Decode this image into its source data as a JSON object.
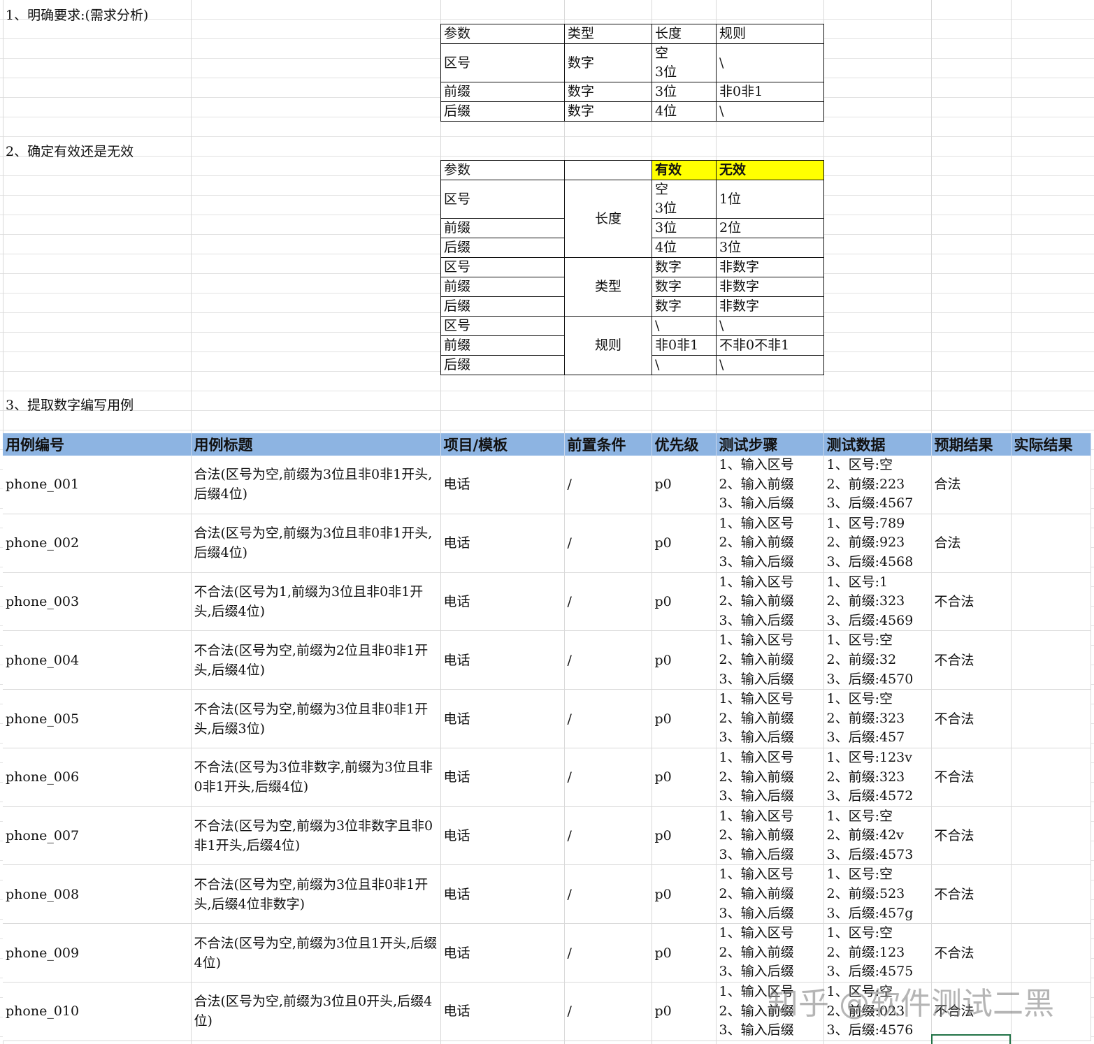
{
  "section1": "1、明确要求:(需求分析)",
  "section2": "2、确定有效还是无效",
  "section3": "3、提取数字编写用例",
  "table1": {
    "headers": [
      "参数",
      "类型",
      "长度",
      "规则"
    ],
    "rows": [
      [
        "区号",
        "数字",
        "空\n3位",
        "\\"
      ],
      [
        "前缀",
        "数字",
        "3位",
        "非0非1"
      ],
      [
        "后缀",
        "数字",
        "4位",
        "\\"
      ]
    ]
  },
  "table2": {
    "header_param": "参数",
    "header_valid": "有效",
    "header_invalid": "无效",
    "groups": [
      {
        "name": "长度",
        "rows": [
          [
            "区号",
            "空\n3位",
            "1位"
          ],
          [
            "前缀",
            "3位",
            "2位"
          ],
          [
            "后缀",
            "4位",
            "3位"
          ]
        ]
      },
      {
        "name": "类型",
        "rows": [
          [
            "区号",
            "数字",
            "非数字"
          ],
          [
            "前缀",
            "数字",
            "非数字"
          ],
          [
            "后缀",
            "数字",
            "非数字"
          ]
        ]
      },
      {
        "name": "规则",
        "rows": [
          [
            "区号",
            "\\",
            "\\"
          ],
          [
            "前缀",
            "非0非1",
            "不非0不非1"
          ],
          [
            "后缀",
            "\\",
            "\\"
          ]
        ]
      }
    ]
  },
  "cases": {
    "headers": [
      "用例编号",
      "用例标题",
      "项目/模板",
      "前置条件",
      "优先级",
      "测试步骤",
      "测试数据",
      "预期结果",
      "实际结果"
    ],
    "rows": [
      {
        "id": "phone_001",
        "title": "合法(区号为空,前缀为3位且非0非1开头,后缀4位)",
        "module": "电话",
        "pre": "/",
        "priority": "p0",
        "steps": [
          "1、输入区号",
          "2、输入前缀",
          "3、输入后缀"
        ],
        "data": [
          "1、区号:空",
          "2、前缀:223",
          "3、后缀:4567"
        ],
        "expected": "合法",
        "actual": ""
      },
      {
        "id": "phone_002",
        "title": "合法(区号为空,前缀为3位且非0非1开头,后缀4位)",
        "module": "电话",
        "pre": "/",
        "priority": "p0",
        "steps": [
          "1、输入区号",
          "2、输入前缀",
          "3、输入后缀"
        ],
        "data": [
          "1、区号:789",
          "2、前缀:923",
          "3、后缀:4568"
        ],
        "expected": "合法",
        "actual": ""
      },
      {
        "id": "phone_003",
        "title": "不合法(区号为1,前缀为3位且非0非1开头,后缀4位)",
        "module": "电话",
        "pre": "/",
        "priority": "p0",
        "steps": [
          "1、输入区号",
          "2、输入前缀",
          "3、输入后缀"
        ],
        "data": [
          "1、区号:1",
          "2、前缀:323",
          "3、后缀:4569"
        ],
        "expected": "不合法",
        "actual": ""
      },
      {
        "id": "phone_004",
        "title": "不合法(区号为空,前缀为2位且非0非1开头,后缀4位)",
        "module": "电话",
        "pre": "/",
        "priority": "p0",
        "steps": [
          "1、输入区号",
          "2、输入前缀",
          "3、输入后缀"
        ],
        "data": [
          "1、区号:空",
          "2、前缀:32",
          "3、后缀:4570"
        ],
        "expected": "不合法",
        "actual": ""
      },
      {
        "id": "phone_005",
        "title": "不合法(区号为空,前缀为3位且非0非1开头,后缀3位)",
        "module": "电话",
        "pre": "/",
        "priority": "p0",
        "steps": [
          "1、输入区号",
          "2、输入前缀",
          "3、输入后缀"
        ],
        "data": [
          "1、区号:空",
          "2、前缀:323",
          "3、后缀:457"
        ],
        "expected": "不合法",
        "actual": ""
      },
      {
        "id": "phone_006",
        "title": "不合法(区号为3位非数字,前缀为3位且非0非1开头,后缀4位)",
        "module": "电话",
        "pre": "/",
        "priority": "p0",
        "steps": [
          "1、输入区号",
          "2、输入前缀",
          "3、输入后缀"
        ],
        "data": [
          "1、区号:123v",
          "2、前缀:323",
          "3、后缀:4572"
        ],
        "expected": "不合法",
        "actual": ""
      },
      {
        "id": "phone_007",
        "title": "不合法(区号为空,前缀为3位非数字且非0非1开头,后缀4位)",
        "module": "电话",
        "pre": "/",
        "priority": "p0",
        "steps": [
          "1、输入区号",
          "2、输入前缀",
          "3、输入后缀"
        ],
        "data": [
          "1、区号:空",
          "2、前缀:42v",
          "3、后缀:4573"
        ],
        "expected": "不合法",
        "actual": ""
      },
      {
        "id": "phone_008",
        "title": "不合法(区号为空,前缀为3位且非0非1开头,后缀4位非数字)",
        "module": "电话",
        "pre": "/",
        "priority": "p0",
        "steps": [
          "1、输入区号",
          "2、输入前缀",
          "3、输入后缀"
        ],
        "data": [
          "1、区号:空",
          "2、前缀:523",
          "3、后缀:457g"
        ],
        "expected": "不合法",
        "actual": ""
      },
      {
        "id": "phone_009",
        "title": "不合法(区号为空,前缀为3位且1开头,后缀4位)",
        "module": "电话",
        "pre": "/",
        "priority": "p0",
        "steps": [
          "1、输入区号",
          "2、输入前缀",
          "3、输入后缀"
        ],
        "data": [
          "1、区号:空",
          "2、前缀:123",
          "3、后缀:4575"
        ],
        "expected": "不合法",
        "actual": ""
      },
      {
        "id": "phone_010",
        "title": "合法(区号为空,前缀为3位且0开头,后缀4位)",
        "module": "电话",
        "pre": "/",
        "priority": "p0",
        "steps": [
          "1、输入区号",
          "2、输入前缀",
          "3、输入后缀"
        ],
        "data": [
          "1、区号:空",
          "2、前缀:023",
          "3、后缀:4576"
        ],
        "expected": "不合法",
        "actual": ""
      }
    ]
  },
  "watermark": "知乎 @软件测试二黑"
}
